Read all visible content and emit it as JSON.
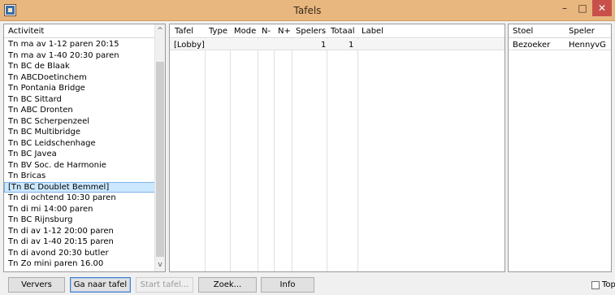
{
  "window": {
    "title": "Tafels",
    "minimize": "–",
    "maximize": "□",
    "close": "✕"
  },
  "activities": {
    "header": "Activiteit",
    "items": [
      "Tn ma av 1-12 paren 20:15",
      "Tn ma av 1-40 20:30 paren",
      "Tn BC de Blaak",
      "Tn ABCDoetinchem",
      "Tn Pontania Bridge",
      "Tn BC Sittard",
      "Tn ABC Dronten",
      "Tn BC Scherpenzeel",
      "Tn BC Multibridge",
      "Tn BC Leidschenhage",
      "Tn BC Javea",
      "Tn BV Soc. de Harmonie",
      "Tn Bricas",
      "[Tn BC Doublet Bemmel]",
      "Tn di ochtend 10:30 paren",
      "Tn di mi 14:00 paren",
      "Tn BC Rijnsburg",
      "Tn di av 1-12 20:00 paren",
      "Tn di av 1-40 20:15 paren",
      "Tn di avond 20:30 butler",
      "Tn Zo mini paren 16.00"
    ],
    "selected_index": 13
  },
  "tables": {
    "columns": [
      "Tafel",
      "Type",
      "Mode",
      "N-",
      "N+",
      "Spelers",
      "Totaal",
      "Label"
    ],
    "rows": [
      {
        "tafel": "[Lobby]",
        "type": "",
        "mode": "",
        "n_min": "",
        "n_plus": "",
        "spelers": "1",
        "totaal": "1",
        "label": ""
      }
    ]
  },
  "seats": {
    "columns": [
      "Stoel",
      "Speler"
    ],
    "rows": [
      {
        "stoel": "Bezoeker",
        "speler": "HennyvG"
      }
    ]
  },
  "buttons": {
    "refresh": "Ververs",
    "go_to_table": "Ga naar tafel",
    "start_table": "Start tafel...",
    "search": "Zoek...",
    "info": "Info",
    "top": "Top"
  },
  "icons": {
    "scroll_up": "^",
    "scroll_down": "v"
  }
}
